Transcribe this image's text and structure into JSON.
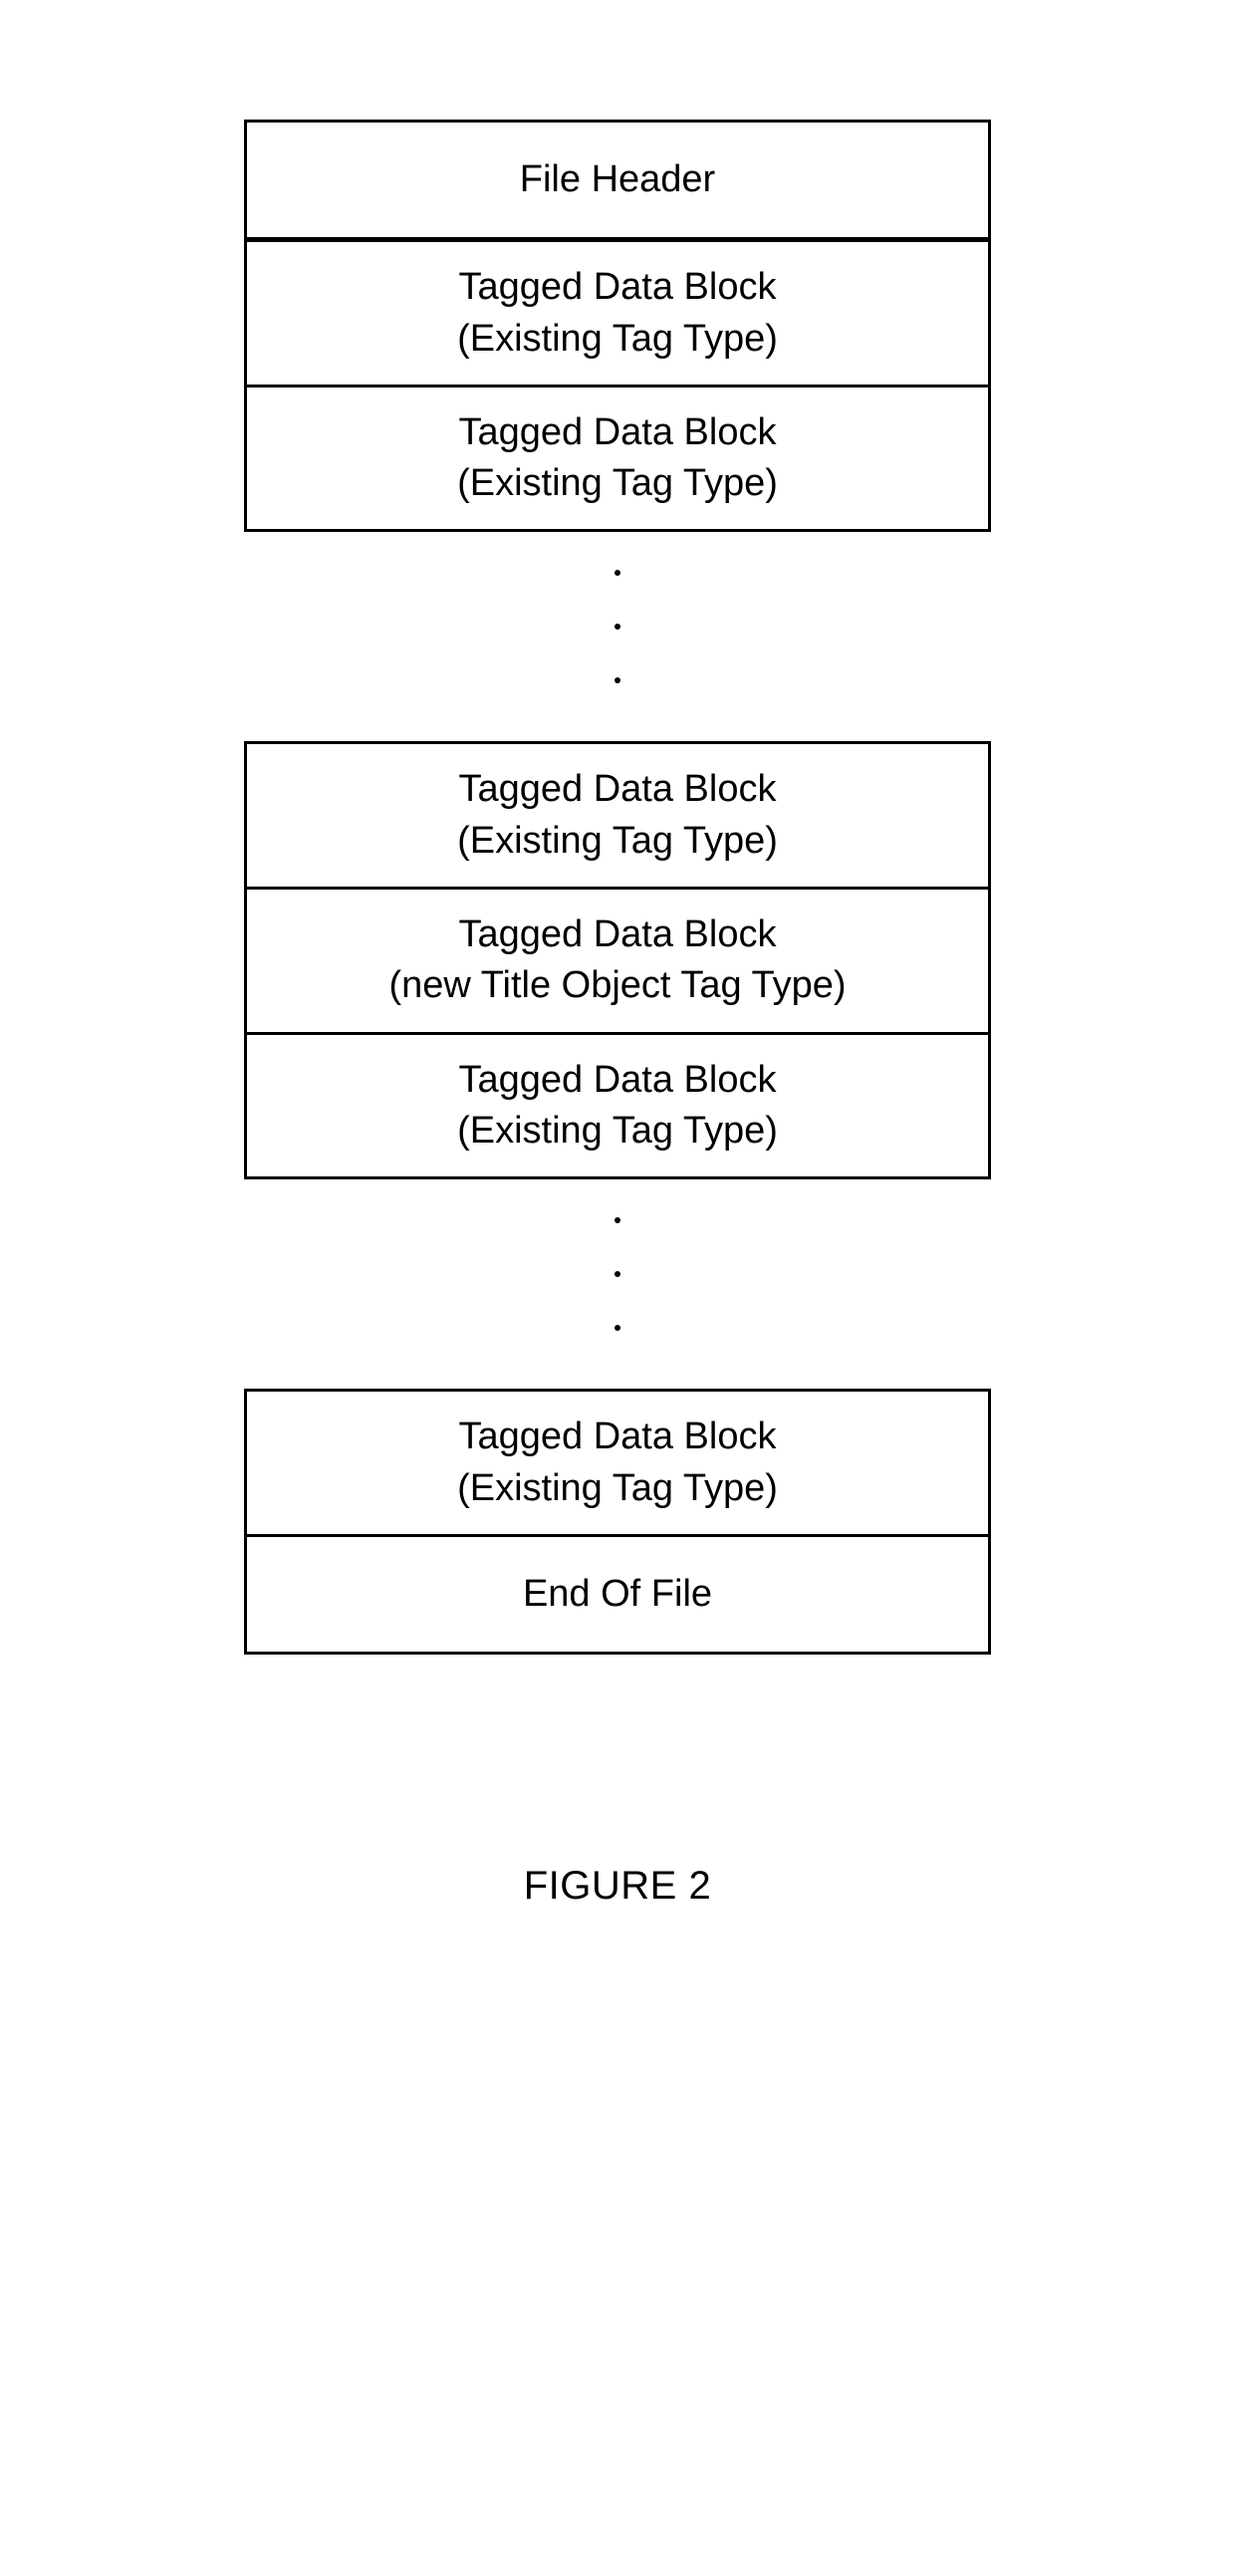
{
  "diagram": {
    "group1": [
      {
        "line1": "File Header",
        "line2": ""
      },
      {
        "line1": "Tagged Data Block",
        "line2": "(Existing Tag Type)"
      },
      {
        "line1": "Tagged Data Block",
        "line2": "(Existing Tag Type)"
      }
    ],
    "group2": [
      {
        "line1": "Tagged Data Block",
        "line2": "(Existing Tag Type)"
      },
      {
        "line1": "Tagged Data Block",
        "line2": "(new Title Object Tag Type)"
      },
      {
        "line1": "Tagged Data Block",
        "line2": "(Existing Tag Type)"
      }
    ],
    "group3": [
      {
        "line1": "Tagged Data Block",
        "line2": "(Existing Tag Type)"
      },
      {
        "line1": "End Of File",
        "line2": ""
      }
    ],
    "caption": "FIGURE 2"
  }
}
